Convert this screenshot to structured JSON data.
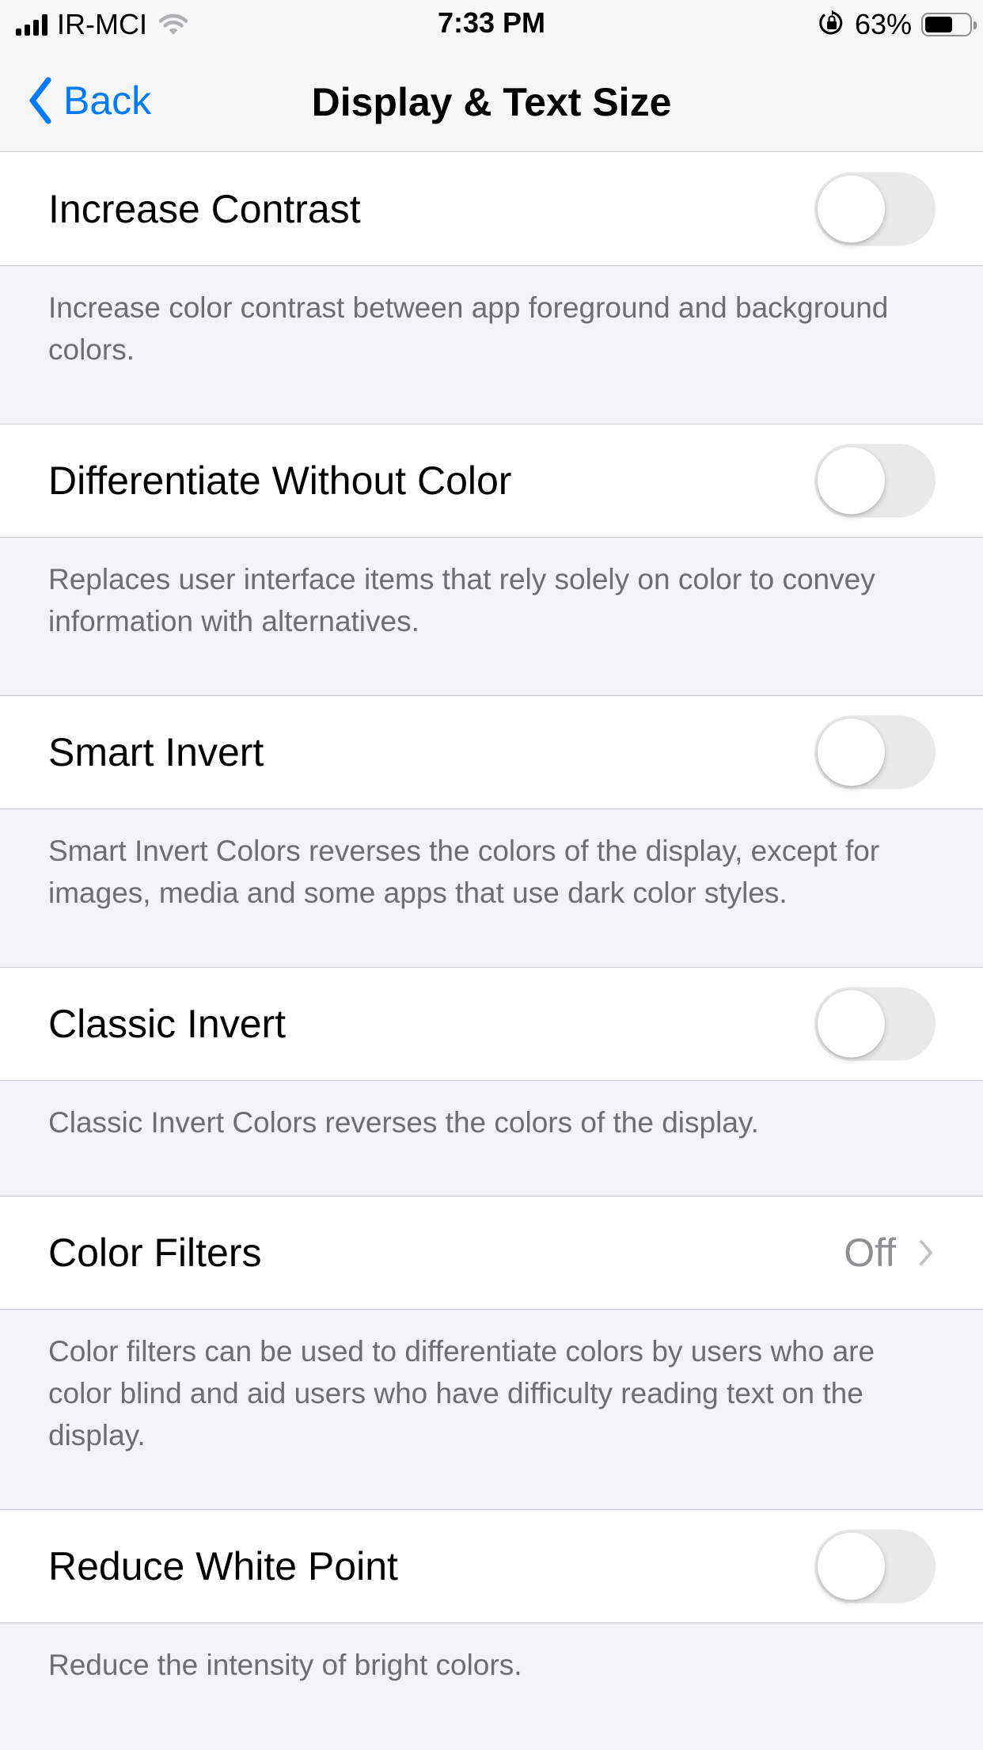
{
  "status_bar": {
    "carrier": "IR-MCI",
    "time": "7:33 PM",
    "battery_percent": "63%",
    "battery_level": 0.63,
    "signal_bars": 4
  },
  "nav": {
    "back_label": "Back",
    "title": "Display & Text Size"
  },
  "settings": [
    {
      "label": "Increase Contrast",
      "type": "toggle",
      "on": false,
      "footer": "Increase color contrast between app foreground and background colors."
    },
    {
      "label": "Differentiate Without Color",
      "type": "toggle",
      "on": false,
      "footer": "Replaces user interface items that rely solely on color to convey information with alternatives."
    },
    {
      "label": "Smart Invert",
      "type": "toggle",
      "on": false,
      "footer": "Smart Invert Colors reverses the colors of the display, except for images, media and some apps that use dark color styles."
    },
    {
      "label": "Classic Invert",
      "type": "toggle",
      "on": false,
      "footer": "Classic Invert Colors reverses the colors of the display."
    },
    {
      "label": "Color Filters",
      "type": "disclosure",
      "value": "Off",
      "footer": "Color filters can be used to differentiate colors by users who are color blind and aid users who have difficulty reading text on the display."
    },
    {
      "label": "Reduce White Point",
      "type": "toggle",
      "on": false,
      "footer": "Reduce the intensity of bright colors."
    }
  ],
  "colors": {
    "accent": "#007aff",
    "background": "#f2f2f7",
    "toggle_off": "#e9e9ea",
    "secondary_text": "#6d6d72"
  }
}
